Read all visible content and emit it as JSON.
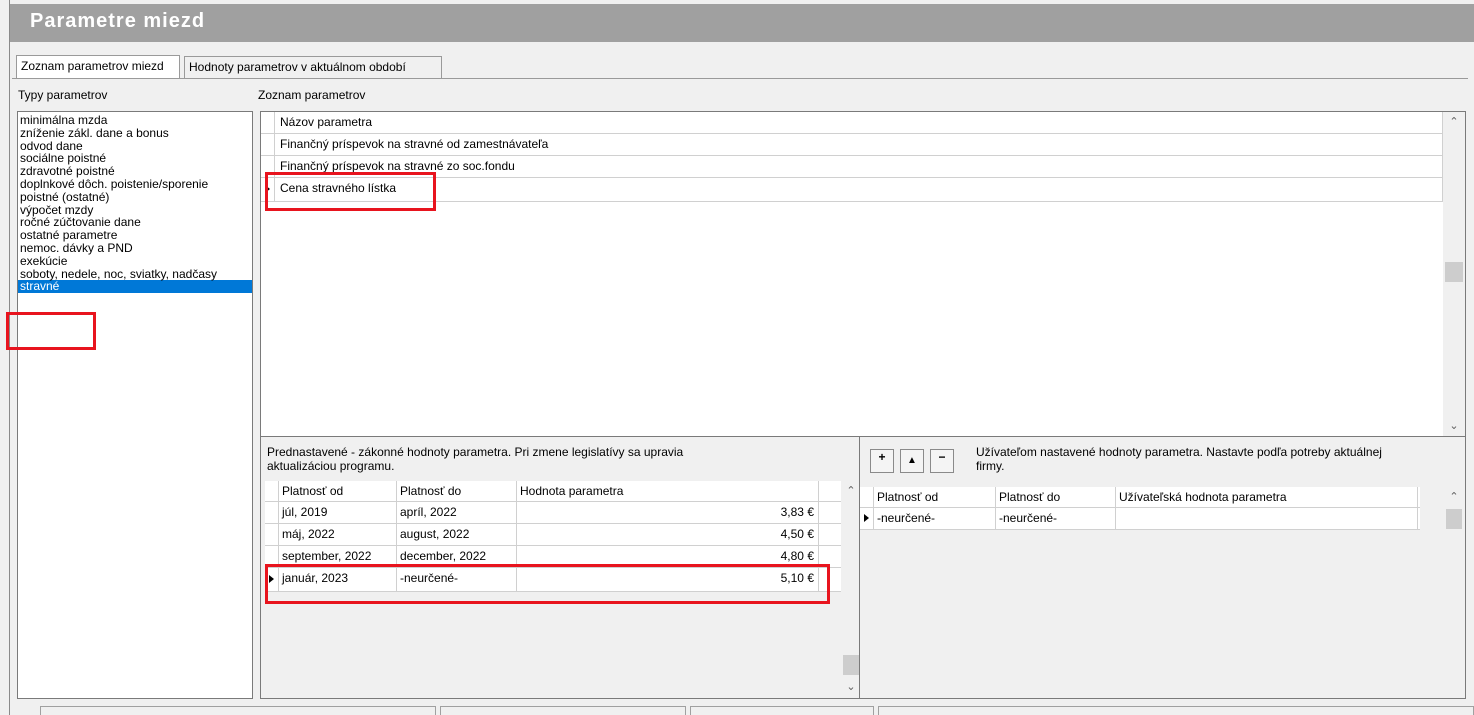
{
  "window": {
    "title": "Parametre miezd"
  },
  "tabs": [
    {
      "label": "Zoznam parametrov miezd",
      "active": true
    },
    {
      "label": "Hodnoty parametrov v aktuálnom období",
      "active": false
    }
  ],
  "types_panel": {
    "label": "Typy parametrov",
    "items": [
      "minimálna mzda",
      "zníženie zákl. dane a bonus",
      "odvod dane",
      "sociálne poistné",
      "zdravotné poistné",
      "doplnkové dôch. poistenie/sporenie",
      "poistné (ostatné)",
      "výpočet mzdy",
      "ročné zúčtovanie dane",
      "ostatné parametre",
      "nemoc. dávky a PND",
      "exekúcie",
      "soboty, nedele, noc, sviatky, nadčasy",
      "stravné"
    ],
    "selected_index": 13
  },
  "params_panel": {
    "label": "Zoznam parametrov",
    "column_header": "Názov parametra",
    "rows": [
      "Finančný príspevok na stravné od zamestnávateľa",
      "Finančný príspevok na stravné zo soc.fondu",
      "Cena stravného lístka"
    ],
    "current_index": 2
  },
  "default_values": {
    "description": "Prednastavené - zákonné hodnoty parametra. Pri zmene legislatívy sa upravia aktualizáciou programu.",
    "columns": [
      "Platnosť od",
      "Platnosť do",
      "Hodnota parametra"
    ],
    "rows": [
      [
        "júl, 2019",
        "apríl, 2022",
        "3,83 €"
      ],
      [
        "máj, 2022",
        "august, 2022",
        "4,50 €"
      ],
      [
        "september, 2022",
        "december, 2022",
        "4,80 €"
      ],
      [
        "január, 2023",
        "-neurčené-",
        "5,10 €"
      ]
    ],
    "current_index": 3
  },
  "user_values": {
    "toolbar": {
      "add": "+",
      "up": "▲",
      "remove": "−"
    },
    "description": "Užívateľom nastavené hodnoty parametra. Nastavte podľa potreby aktuálnej firmy.",
    "columns": [
      "Platnosť od",
      "Platnosť do",
      "Užívateľská hodnota parametra"
    ],
    "rows": [
      [
        "-neurčené-",
        "-neurčené-",
        ""
      ]
    ],
    "current_index": 0
  },
  "colors": {
    "title_bar": "#a0a0a0",
    "selection": "#0078d7",
    "highlight_box": "#e8141e"
  }
}
